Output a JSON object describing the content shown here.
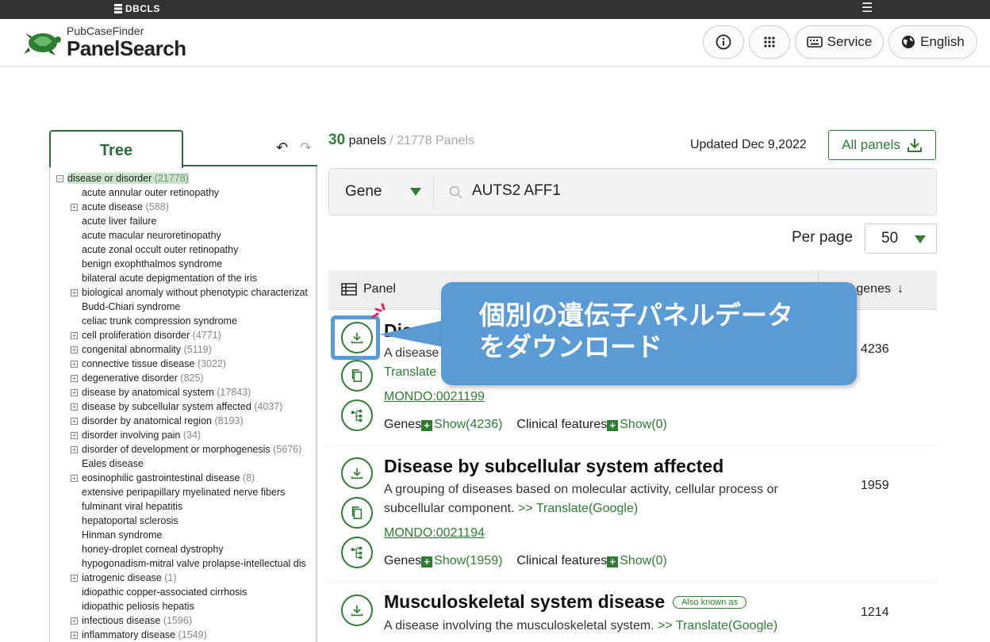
{
  "topbar": {
    "brand": "DBCLS",
    "menu_icon": "hamburger-icon"
  },
  "header": {
    "logo_sub": "PubCaseFinder",
    "logo_main": "PanelSearch",
    "service_label": "Service",
    "language_label": "English"
  },
  "tree": {
    "tab_label": "Tree",
    "root": {
      "label": "disease or disorder",
      "count": "(21778)"
    },
    "items": [
      {
        "label": "acute annular outer retinopathy",
        "count": "",
        "expandable": false
      },
      {
        "label": "acute disease",
        "count": "(588)",
        "expandable": true
      },
      {
        "label": "acute liver failure",
        "count": "",
        "expandable": false
      },
      {
        "label": "acute macular neuroretinopathy",
        "count": "",
        "expandable": false
      },
      {
        "label": "acute zonal occult outer retinopathy",
        "count": "",
        "expandable": false
      },
      {
        "label": "benign exophthalmos syndrome",
        "count": "",
        "expandable": false
      },
      {
        "label": "bilateral acute depigmentation of the iris",
        "count": "",
        "expandable": false
      },
      {
        "label": "biological anomaly without phenotypic characterizat",
        "count": "",
        "expandable": true
      },
      {
        "label": "Budd-Chiari syndrome",
        "count": "",
        "expandable": false
      },
      {
        "label": "celiac trunk compression syndrome",
        "count": "",
        "expandable": false
      },
      {
        "label": "cell proliferation disorder",
        "count": "(4771)",
        "expandable": true
      },
      {
        "label": "congenital abnormality",
        "count": "(5119)",
        "expandable": true
      },
      {
        "label": "connective tissue disease",
        "count": "(3022)",
        "expandable": true
      },
      {
        "label": "degenerative disorder",
        "count": "(825)",
        "expandable": true
      },
      {
        "label": "disease by anatomical system",
        "count": "(17843)",
        "expandable": true
      },
      {
        "label": "disease by subcellular system affected",
        "count": "(4037)",
        "expandable": true
      },
      {
        "label": "disorder by anatomical region",
        "count": "(8193)",
        "expandable": true
      },
      {
        "label": "disorder involving pain",
        "count": "(34)",
        "expandable": true
      },
      {
        "label": "disorder of development or morphogenesis",
        "count": "(5676)",
        "expandable": true
      },
      {
        "label": "Eales disease",
        "count": "",
        "expandable": false
      },
      {
        "label": "eosinophilic gastrointestinal disease",
        "count": "(8)",
        "expandable": true
      },
      {
        "label": "extensive peripapillary myelinated nerve fibers",
        "count": "",
        "expandable": false
      },
      {
        "label": "fulminant viral hepatitis",
        "count": "",
        "expandable": false
      },
      {
        "label": "hepatoportal sclerosis",
        "count": "",
        "expandable": false
      },
      {
        "label": "Hinman syndrome",
        "count": "",
        "expandable": false
      },
      {
        "label": "honey-droplet corneal dystrophy",
        "count": "",
        "expandable": false
      },
      {
        "label": "hypogonadism-mitral valve prolapse-intellectual dis",
        "count": "",
        "expandable": false
      },
      {
        "label": "iatrogenic disease",
        "count": "(1)",
        "expandable": true
      },
      {
        "label": "idiopathic copper-associated cirrhosis",
        "count": "",
        "expandable": false
      },
      {
        "label": "idiopathic peliosis hepatis",
        "count": "",
        "expandable": false
      },
      {
        "label": "infectious disease",
        "count": "(1596)",
        "expandable": true
      },
      {
        "label": "inflammatory disease",
        "count": "(1549)",
        "expandable": true
      }
    ]
  },
  "results": {
    "count": "30",
    "count_unit": "panels",
    "total": "/ 21778 Panels",
    "updated": "Updated Dec 9,2022",
    "all_panels_label": "All panels"
  },
  "search": {
    "type": "Gene",
    "query": "AUTS2 AFF1"
  },
  "per_page": {
    "label": "Per page",
    "value": "50"
  },
  "table": {
    "col_panel": "Panel",
    "col_genes": "Panel genes"
  },
  "rows": [
    {
      "title": "Disease",
      "desc_visible": "A disease",
      "translate": "Translate",
      "mondo": "MONDO:0021199",
      "genes_label": "Genes",
      "genes_show": "Show(4236)",
      "clinical_label": "Clinical features",
      "clinical_show": "Show(0)",
      "count": "4236"
    },
    {
      "title": "Disease by subcellular system affected",
      "desc1": "A grouping of diseases based on molecular activity, cellular process or",
      "desc2": "subcellular component.",
      "translate": ">> Translate(Google)",
      "mondo": "MONDO:0021194",
      "genes_label": "Genes",
      "genes_show": "Show(1959)",
      "clinical_label": "Clinical features",
      "clinical_show": "Show(0)",
      "count": "1959"
    },
    {
      "title": "Musculoskeletal system disease",
      "aka": "Also known as",
      "desc1": "A disease involving the musculoskeletal system.",
      "translate": ">> Translate(Google)",
      "count": "1214"
    }
  ],
  "callout": {
    "line1": "個別の遺伝子パネルデータ",
    "line2": "をダウンロード"
  },
  "colors": {
    "accent": "#2e7d32",
    "callout": "#5b9bd5",
    "tree": "#2d6a3e"
  }
}
